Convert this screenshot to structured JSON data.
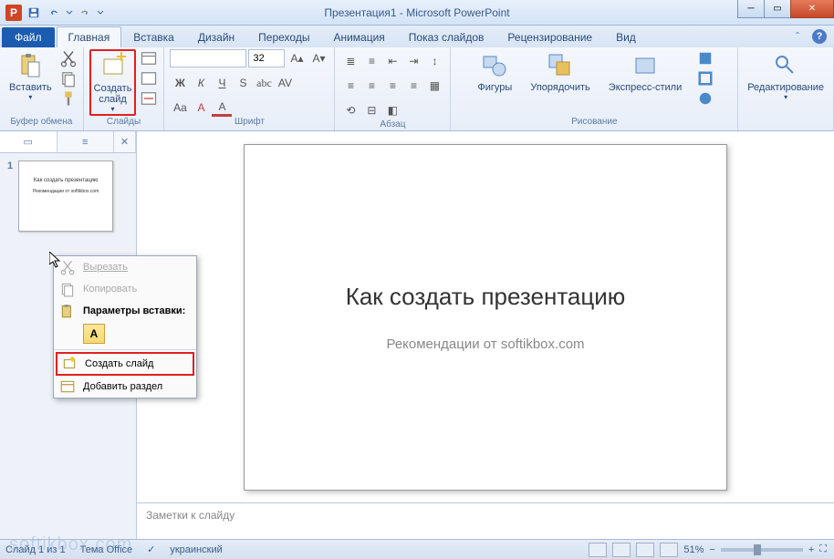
{
  "titlebar": {
    "app_initial": "P",
    "title": "Презентация1 - Microsoft PowerPoint"
  },
  "tabs": {
    "file": "Файл",
    "items": [
      "Главная",
      "Вставка",
      "Дизайн",
      "Переходы",
      "Анимация",
      "Показ слайдов",
      "Рецензирование",
      "Вид"
    ]
  },
  "ribbon": {
    "clipboard": {
      "label": "Буфер обмена",
      "paste": "Вставить"
    },
    "slides": {
      "label": "Слайды",
      "new_slide": "Создать\nслайд"
    },
    "font": {
      "label": "Шрифт",
      "size": "32"
    },
    "paragraph": {
      "label": "Абзац"
    },
    "drawing": {
      "label": "Рисование",
      "shapes": "Фигуры",
      "arrange": "Упорядочить",
      "styles": "Экспресс-стили"
    },
    "editing": {
      "label": "",
      "edit": "Редактирование"
    }
  },
  "panel": {
    "slide_num": "1",
    "thumb_title": "Как создать презентацию",
    "thumb_sub": "Рекомендации от softikbox.com"
  },
  "slide": {
    "title": "Как создать презентацию",
    "subtitle": "Рекомендации от softikbox.com"
  },
  "notes": {
    "placeholder": "Заметки к слайду"
  },
  "context_menu": {
    "cut": "Вырезать",
    "copy": "Копировать",
    "paste_options": "Параметры вставки:",
    "paste_opt_a": "A",
    "new_slide": "Создать слайд",
    "add_section": "Добавить раздел"
  },
  "statusbar": {
    "slide_info": "Слайд 1 из 1",
    "theme": "Тема Office",
    "language": "украинский",
    "zoom": "51%"
  },
  "watermark": "softikbox.com"
}
